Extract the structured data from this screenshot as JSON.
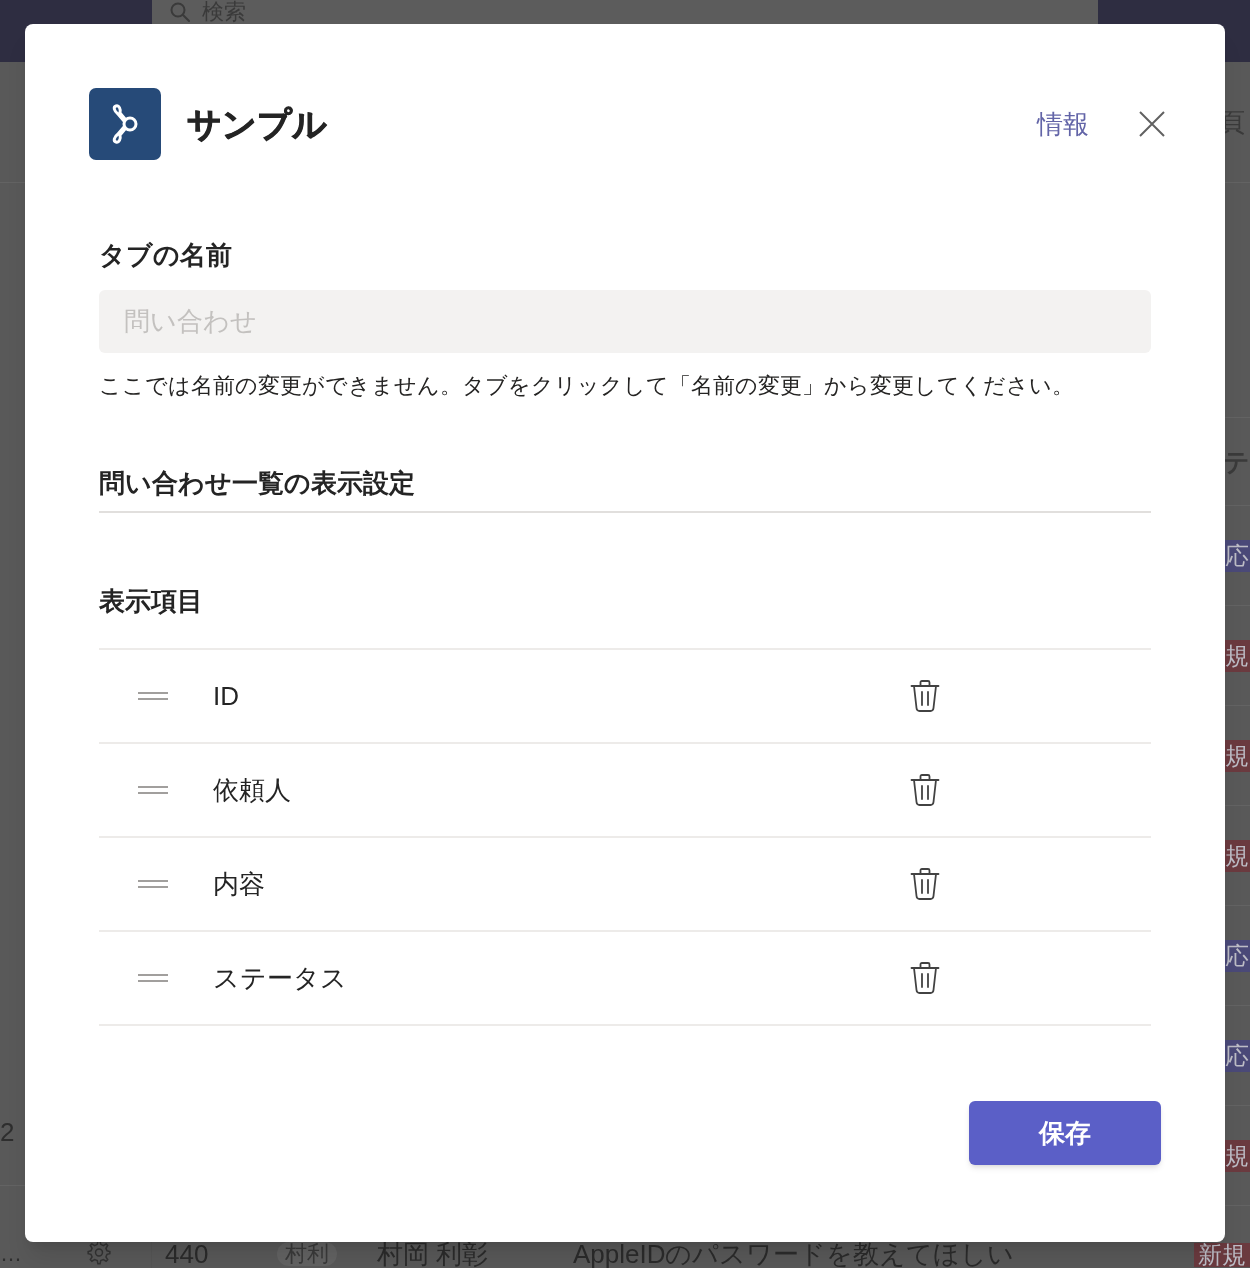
{
  "background_app": {
    "search": {
      "placeholder": "検索"
    },
    "header_fragment": "頁",
    "column_header": "テ",
    "sidebar": {
      "count_fragment": "2",
      "more": "…"
    },
    "rows": [
      {
        "status": "応",
        "color": "#4a4978"
      },
      {
        "status": "規",
        "color": "#6b3a3f"
      },
      {
        "status": "規",
        "color": "#6b3a3f"
      },
      {
        "status": "規",
        "color": "#6b3a3f"
      },
      {
        "status": "応",
        "color": "#4a4978"
      },
      {
        "status": "応",
        "color": "#4a4978"
      },
      {
        "status": "規",
        "color": "#6b3a3f"
      }
    ],
    "last_row": {
      "id": "440",
      "initials": "村利",
      "requester": "村岡 利彰",
      "content": "AppleIDのパスワードを教えてほしい",
      "status": "新規",
      "color": "#6b3a3f"
    }
  },
  "dialog": {
    "app_name": "サンプル",
    "info_link": "情報",
    "tab_name": {
      "label": "タブの名前",
      "value": "問い合わせ",
      "disabled": true,
      "hint": "ここでは名前の変更ができません。タブをクリックして「名前の変更」から変更してください。"
    },
    "section_title": "問い合わせ一覧の表示設定",
    "display_items": {
      "label": "表示項目",
      "items": [
        {
          "label": "ID"
        },
        {
          "label": "依頼人"
        },
        {
          "label": "内容"
        },
        {
          "label": "ステータス"
        }
      ]
    },
    "save_button": "保存"
  }
}
